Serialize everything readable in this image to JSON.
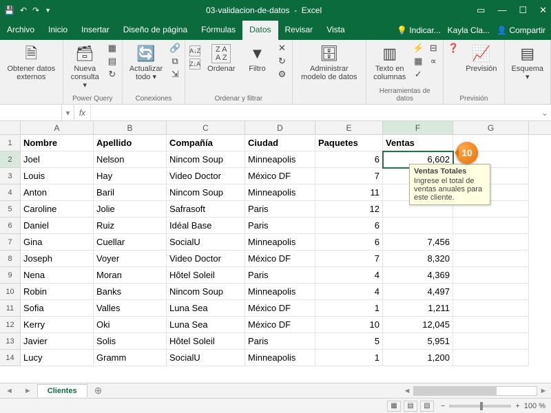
{
  "titlebar": {
    "filename": "03-validacion-de-datos",
    "appname": "Excel"
  },
  "tabs": [
    "Archivo",
    "Inicio",
    "Insertar",
    "Diseño de página",
    "Fórmulas",
    "Datos",
    "Revisar",
    "Vista"
  ],
  "active_tab_index": 5,
  "topright": {
    "tell_me": "Indicar...",
    "user": "Kayla Cla...",
    "share": "Compartir"
  },
  "ribbon": {
    "obtener_datos": "Obtener datos externos",
    "nueva_consulta": "Nueva consulta",
    "power_query": "Power Query",
    "actualizar": "Actualizar todo",
    "conexiones": "Conexiones",
    "ordenar": "Ordenar",
    "filtro": "Filtro",
    "ordenar_filtrar": "Ordenar y filtrar",
    "modelo": "Administrar modelo de datos",
    "texto_cols": "Texto en columnas",
    "herramientas_datos": "Herramientas de datos",
    "prevision": "Previsión",
    "esquema": "Esquema"
  },
  "formula_bar": {
    "name_box": "",
    "formula": ""
  },
  "headers": [
    "Nombre",
    "Apellido",
    "Compañía",
    "Ciudad",
    "Paquetes",
    "Ventas"
  ],
  "rows": [
    {
      "n": "Joel",
      "a": "Nelson",
      "c": "Nincom Soup",
      "ci": "Minneapolis",
      "p": "6",
      "v": "6,602"
    },
    {
      "n": "Louis",
      "a": "Hay",
      "c": "Video Doctor",
      "ci": "México DF",
      "p": "7",
      "v": ""
    },
    {
      "n": "Anton",
      "a": "Baril",
      "c": "Nincom Soup",
      "ci": "Minneapolis",
      "p": "11",
      "v": ""
    },
    {
      "n": "Caroline",
      "a": "Jolie",
      "c": "Safrasoft",
      "ci": "Paris",
      "p": "12",
      "v": ""
    },
    {
      "n": "Daniel",
      "a": "Ruiz",
      "c": "Idéal Base",
      "ci": "Paris",
      "p": "6",
      "v": ""
    },
    {
      "n": "Gina",
      "a": "Cuellar",
      "c": "SocialU",
      "ci": "Minneapolis",
      "p": "6",
      "v": "7,456"
    },
    {
      "n": "Joseph",
      "a": "Voyer",
      "c": "Video Doctor",
      "ci": "México DF",
      "p": "7",
      "v": "8,320"
    },
    {
      "n": "Nena",
      "a": "Moran",
      "c": "Hôtel Soleil",
      "ci": "Paris",
      "p": "4",
      "v": "4,369"
    },
    {
      "n": "Robin",
      "a": "Banks",
      "c": "Nincom Soup",
      "ci": "Minneapolis",
      "p": "4",
      "v": "4,497"
    },
    {
      "n": "Sofia",
      "a": "Valles",
      "c": "Luna Sea",
      "ci": "México DF",
      "p": "1",
      "v": "1,211"
    },
    {
      "n": "Kerry",
      "a": "Oki",
      "c": "Luna Sea",
      "ci": "México DF",
      "p": "10",
      "v": "12,045"
    },
    {
      "n": "Javier",
      "a": "Solis",
      "c": "Hôtel Soleil",
      "ci": "Paris",
      "p": "5",
      "v": "5,951"
    },
    {
      "n": "Lucy",
      "a": "Gramm",
      "c": "SocialU",
      "ci": "Minneapolis",
      "p": "1",
      "v": "1,200"
    }
  ],
  "selected": {
    "col": "F",
    "row": 2
  },
  "tooltip": {
    "title": "Ventas Totales",
    "body": "Ingrese el total de ventas anuales para este cliente."
  },
  "callout": "10",
  "sheet": {
    "active": "Clientes"
  },
  "status": {
    "zoom": "100 %"
  }
}
